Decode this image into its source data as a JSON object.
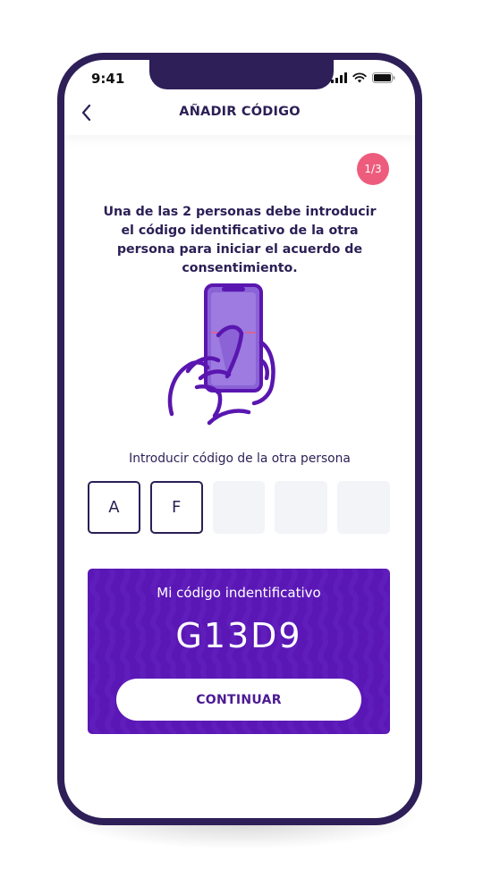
{
  "status_bar": {
    "time": "9:41"
  },
  "header": {
    "title": "AÑADIR CÓDIGO"
  },
  "step": {
    "badge": "1/3"
  },
  "intro_text": "Una de las 2 personas debe introducir el código identificativo de la otra persona para iniciar el acuerdo de consentimiento.",
  "code_entry": {
    "label": "Introducir código de la otra persona",
    "boxes": [
      "A",
      "F",
      "",
      "",
      ""
    ]
  },
  "my_code": {
    "label": "Mi código indentificativo",
    "value": "G13D9",
    "button_label": "CONTINUAR"
  },
  "colors": {
    "frame": "#2e1f58",
    "primary_text": "#2b1f55",
    "card_purple": "#5b17b5",
    "badge_pink": "#ee5c7d",
    "button_text": "#4b1a94"
  },
  "icons": [
    "back-chevron-icon",
    "signal-icon",
    "wifi-icon",
    "battery-icon"
  ]
}
